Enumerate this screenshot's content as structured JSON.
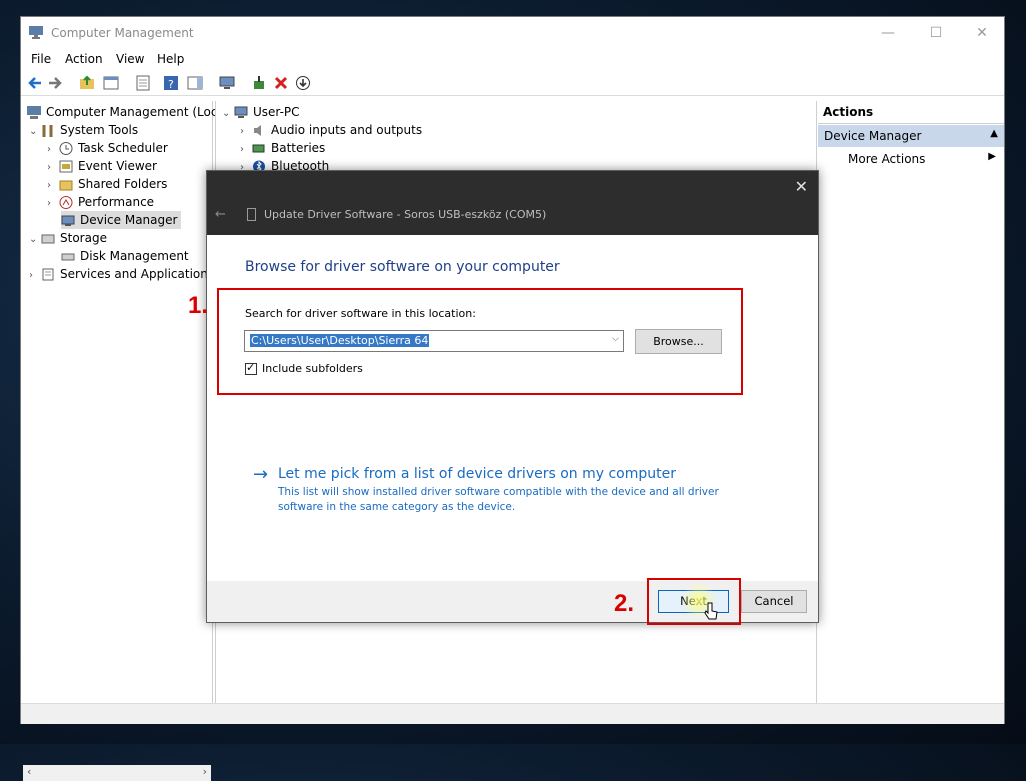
{
  "window": {
    "title": "Computer Management",
    "minimize": "—",
    "maximize": "☐",
    "close": "✕"
  },
  "menu": [
    "File",
    "Action",
    "View",
    "Help"
  ],
  "tree": {
    "root": "Computer Management (Local",
    "system_tools": "System Tools",
    "task_scheduler": "Task Scheduler",
    "event_viewer": "Event Viewer",
    "shared_folders": "Shared Folders",
    "performance": "Performance",
    "device_manager": "Device Manager",
    "storage": "Storage",
    "disk_management": "Disk Management",
    "services": "Services and Applications"
  },
  "devices": {
    "computer": "User-PC",
    "items": [
      "Audio inputs and outputs",
      "Batteries",
      "Bluetooth"
    ]
  },
  "actions": {
    "header": "Actions",
    "device_manager": "Device Manager",
    "more_actions": "More Actions"
  },
  "dialog": {
    "title": "Update Driver Software - Soros USB-eszköz (COM5)",
    "heading": "Browse for driver software on your computer",
    "search_label": "Search for driver software in this location:",
    "path_value": "C:\\Users\\User\\Desktop\\Sierra 64",
    "browse": "Browse...",
    "include_subfolders": "Include subfolders",
    "include_subfolders_checked": true,
    "pick_link": "Let me pick from a list of device drivers on my computer",
    "pick_desc": "This list will show installed driver software compatible with the device and all driver software in the same category as the device.",
    "next": "Next",
    "cancel": "Cancel"
  },
  "annotations": {
    "step1": "1.",
    "step2": "2.",
    "color": "#d90000"
  },
  "colors": {
    "accent_blue": "#1a6bc2",
    "dialog_header": "#2d2d2d",
    "selection": "#3478c6"
  }
}
